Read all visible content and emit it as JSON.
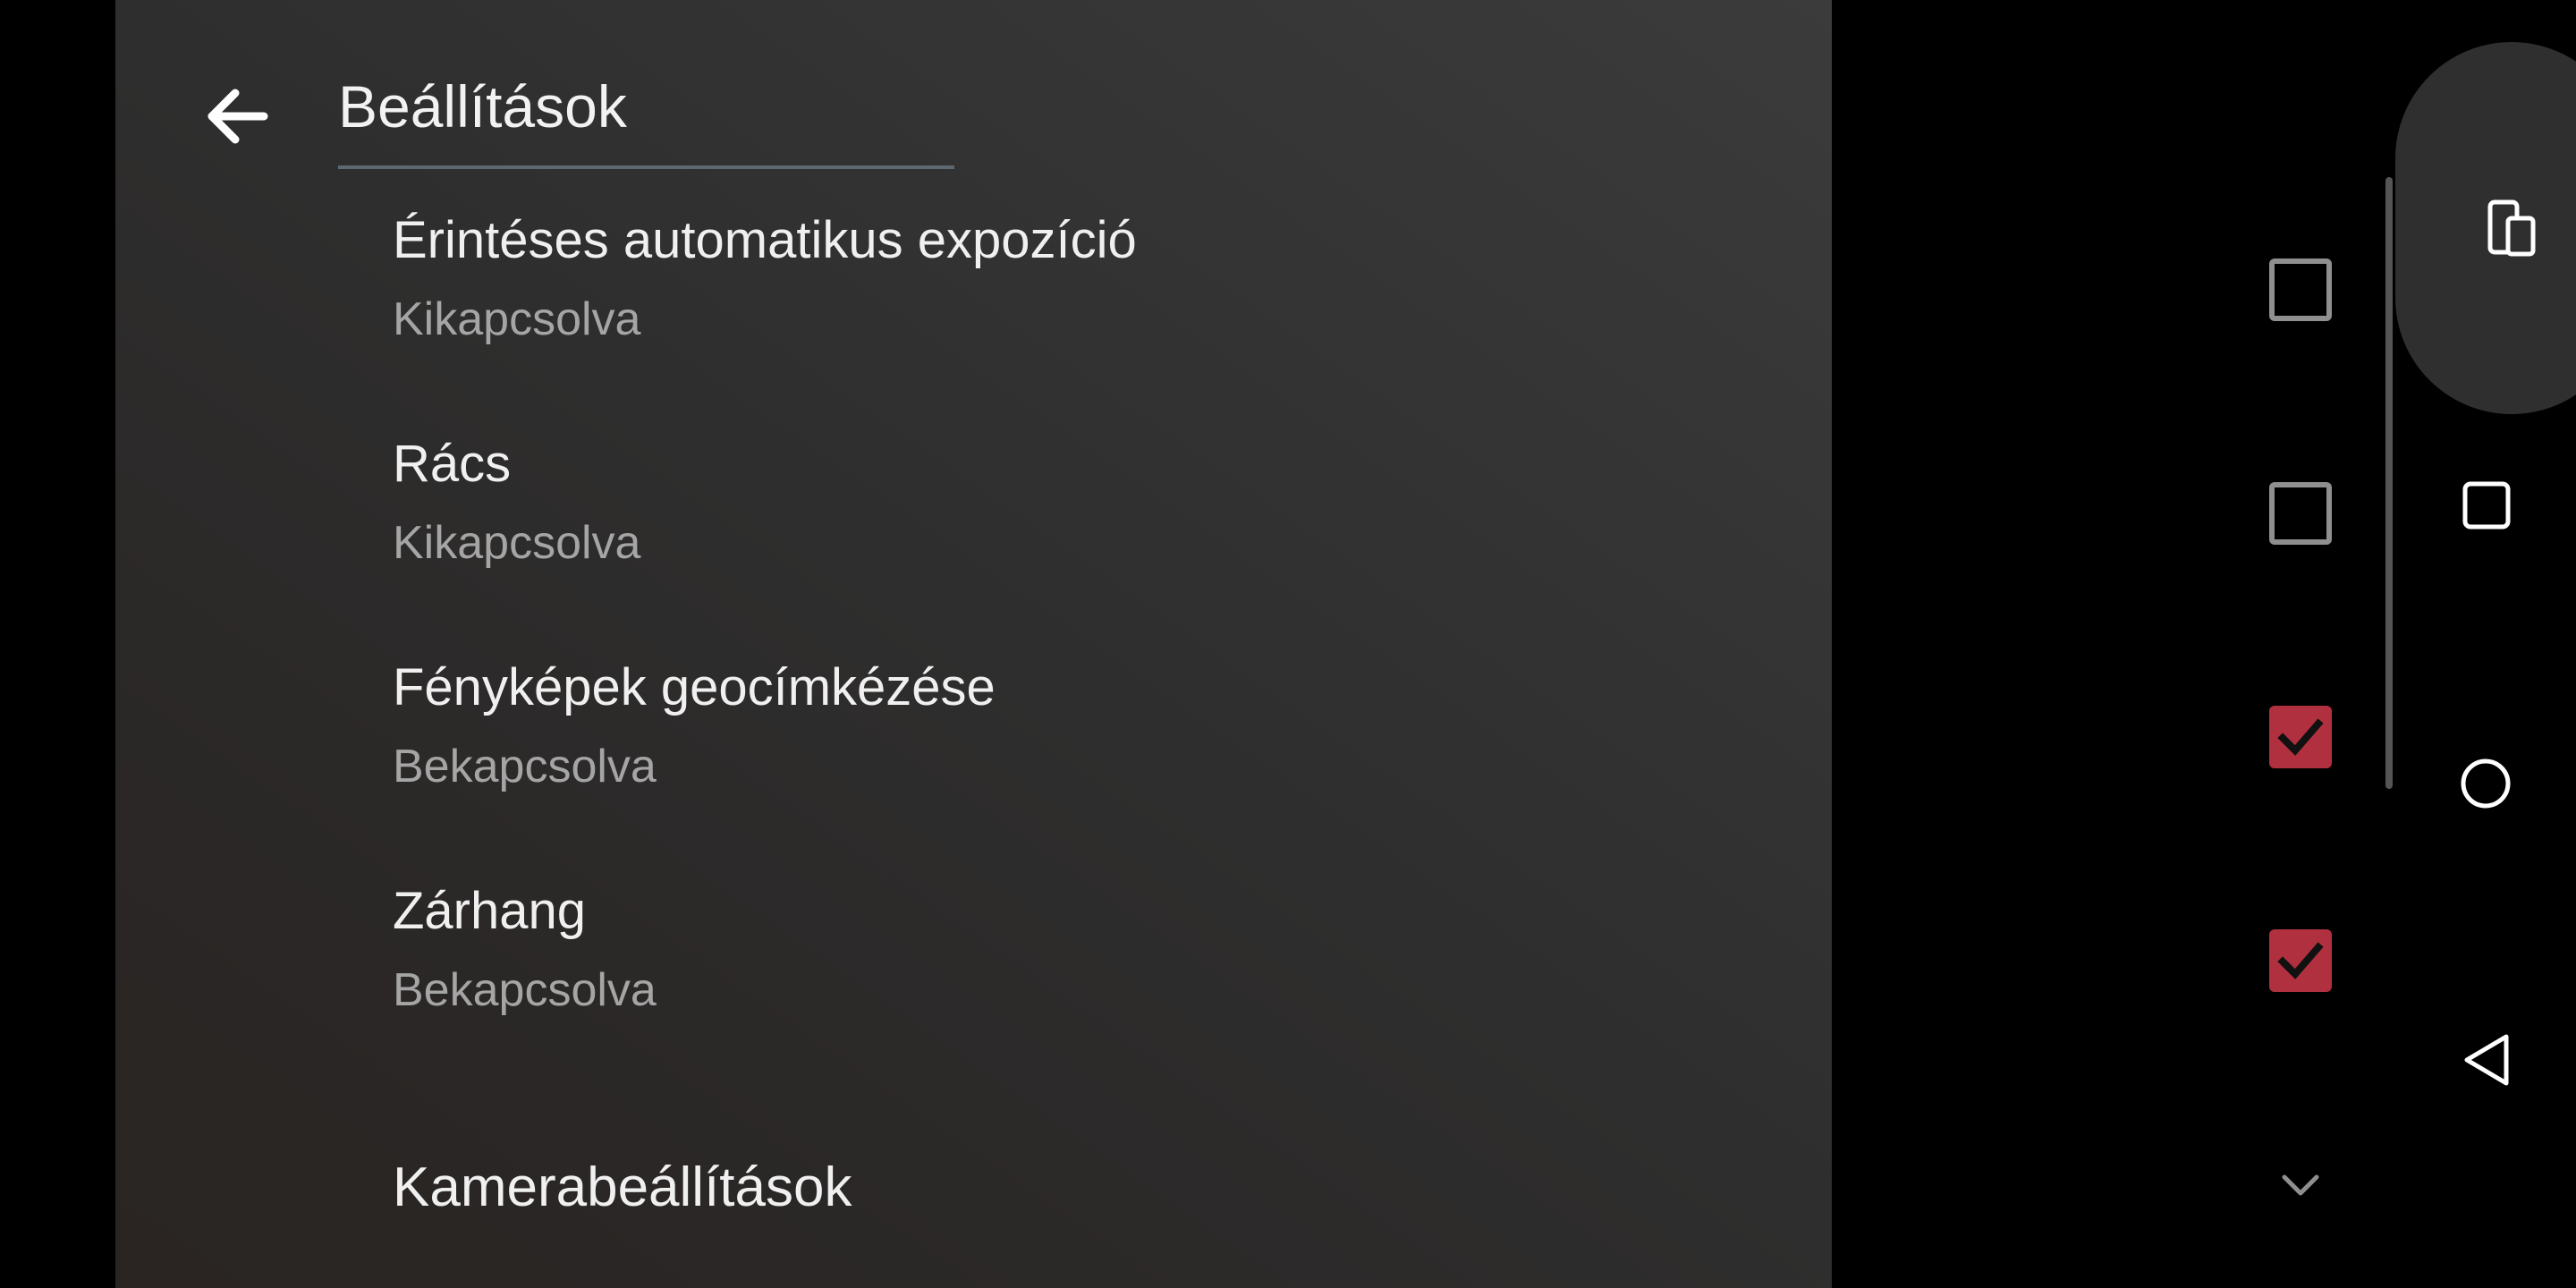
{
  "header": {
    "title": "Beállítások",
    "back_icon": "arrow-left-icon"
  },
  "settings": [
    {
      "title": "Érintéses automatikus expozíció",
      "status": "Kikapcsolva",
      "checked": false
    },
    {
      "title": "Rács",
      "status": "Kikapcsolva",
      "checked": false
    },
    {
      "title": "Fényképek geocímkézése",
      "status": "Bekapcsolva",
      "checked": true
    },
    {
      "title": "Zárhang",
      "status": "Bekapcsolva",
      "checked": true
    }
  ],
  "section": {
    "title": "Kamerabeállítások",
    "expand_icon": "chevron-down-icon"
  },
  "navbar": {
    "icons": [
      "rotate-screen-icon",
      "recents-icon",
      "home-icon",
      "back-icon"
    ]
  },
  "colors": {
    "accent": "#b1303f",
    "background": "#2f2f2f",
    "text_primary": "#f0f0f0",
    "text_secondary": "#a5a5a5"
  }
}
